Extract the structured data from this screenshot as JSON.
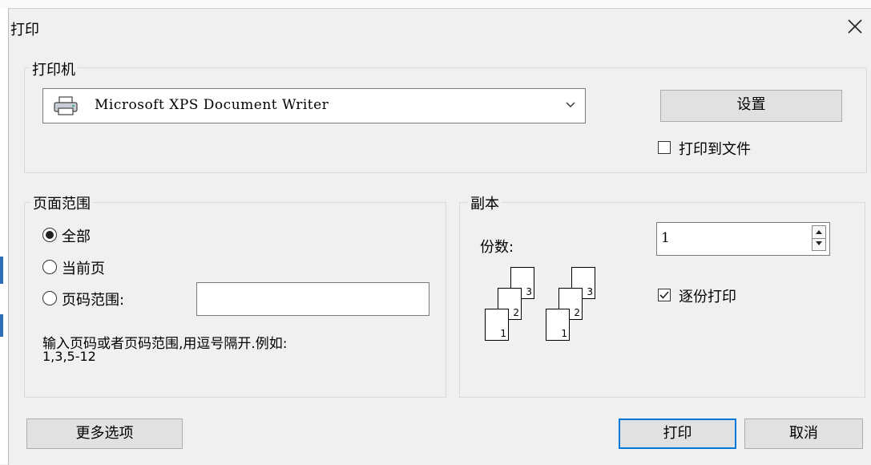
{
  "dialog": {
    "title": "打印",
    "close_glyph": "✕"
  },
  "printer_group": {
    "legend": "打印机",
    "printer_icon": "printer-icon",
    "selected_printer": "Microsoft XPS Document Writer",
    "setup_label": "设置",
    "print_to_file_label": "打印到文件",
    "print_to_file_checked": false
  },
  "page_range": {
    "legend": "页面范围",
    "options": [
      {
        "label": "全部",
        "checked": true
      },
      {
        "label": "当前页",
        "checked": false
      },
      {
        "label": "页码范围:",
        "checked": false
      }
    ],
    "range_value": "",
    "hint_line1": "输入页码或者页码范围,用逗号隔开.例如:",
    "hint_line2": "1,3,5-12"
  },
  "copies": {
    "legend": "副本",
    "count_label": "份数:",
    "count_value": "1",
    "collate_label": "逐份打印",
    "collate_checked": true,
    "collate_pages": [
      "1",
      "2",
      "3"
    ]
  },
  "footer": {
    "more_options_label": "更多选项",
    "print_label": "打印",
    "cancel_label": "取消"
  }
}
